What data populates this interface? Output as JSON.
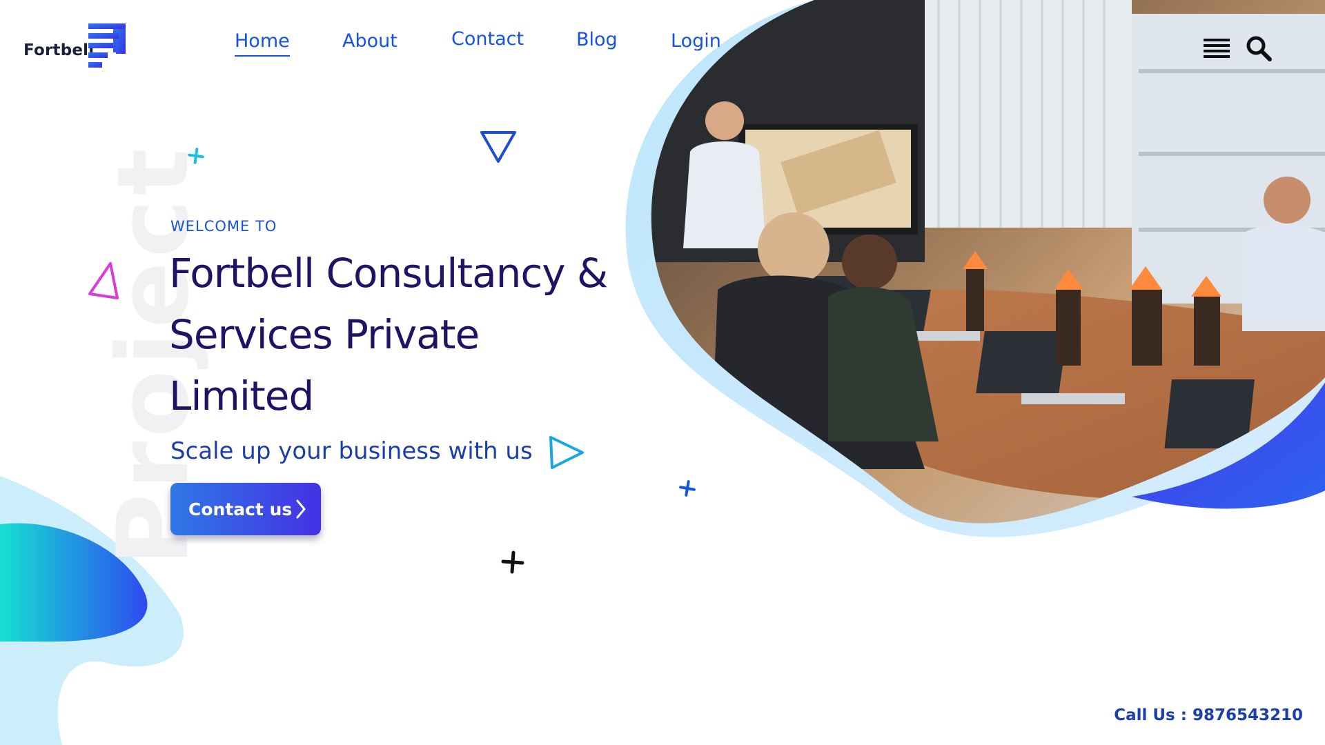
{
  "brand": {
    "name": "Fortbell",
    "logo_icon": "stepped-bars-logo"
  },
  "nav": {
    "home": "Home",
    "about": "About",
    "contact": "Contact",
    "blog": "Blog",
    "login": "Login",
    "active": "Home"
  },
  "toolbar": {
    "menu_icon": "hamburger-menu-icon",
    "search_icon": "magnifier-icon"
  },
  "hero": {
    "watermark": "Project",
    "welcome": "WELCOME TO",
    "title": "Fortbell Consultancy & Services Private Limited",
    "tagline": "Scale up your business with us",
    "cta_label": "Contact us",
    "photo_alt": "Team meeting in a conference room with laptops and a presenter"
  },
  "footer": {
    "call_label": "Call Us : 9876543210"
  },
  "colors": {
    "primary": "#1652e6",
    "title": "#1d1466",
    "accent_cyan": "#18d0e0",
    "accent_purple": "#7b34e8",
    "accent_pink": "#d93bd6"
  }
}
